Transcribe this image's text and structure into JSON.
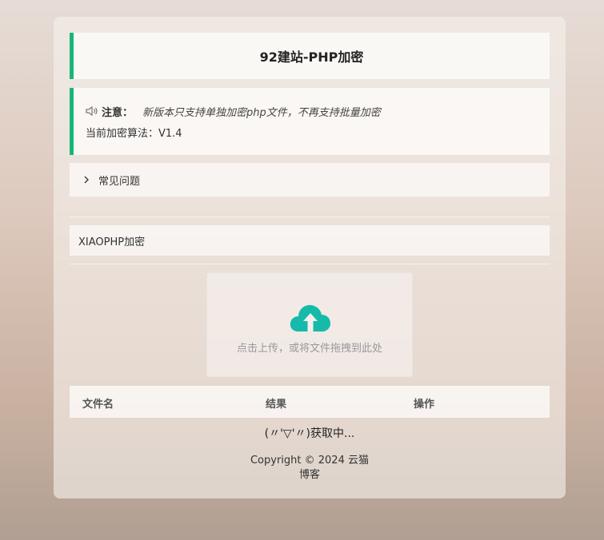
{
  "title": "92建站-PHP加密",
  "notice": {
    "label": "注意：",
    "text": "新版本只支持单独加密php文件，不再支持批量加密",
    "algorithm": "当前加密算法：V1.4"
  },
  "faq": {
    "label": "常见问题"
  },
  "encrypt_option": "XIAOPHP加密",
  "upload": {
    "hint": "点击上传，或将文件拖拽到此处",
    "icon": "cloud-upload-icon",
    "icon_color": "#16baaa"
  },
  "table": {
    "headers": [
      "文件名",
      "结果",
      "操作"
    ]
  },
  "loading_text": "(〃'▽'〃)获取中...",
  "footer": {
    "copyright": "Copyright © 2024 云猫",
    "copyright_line2": "博客"
  },
  "colors": {
    "accent": "#16b777"
  }
}
